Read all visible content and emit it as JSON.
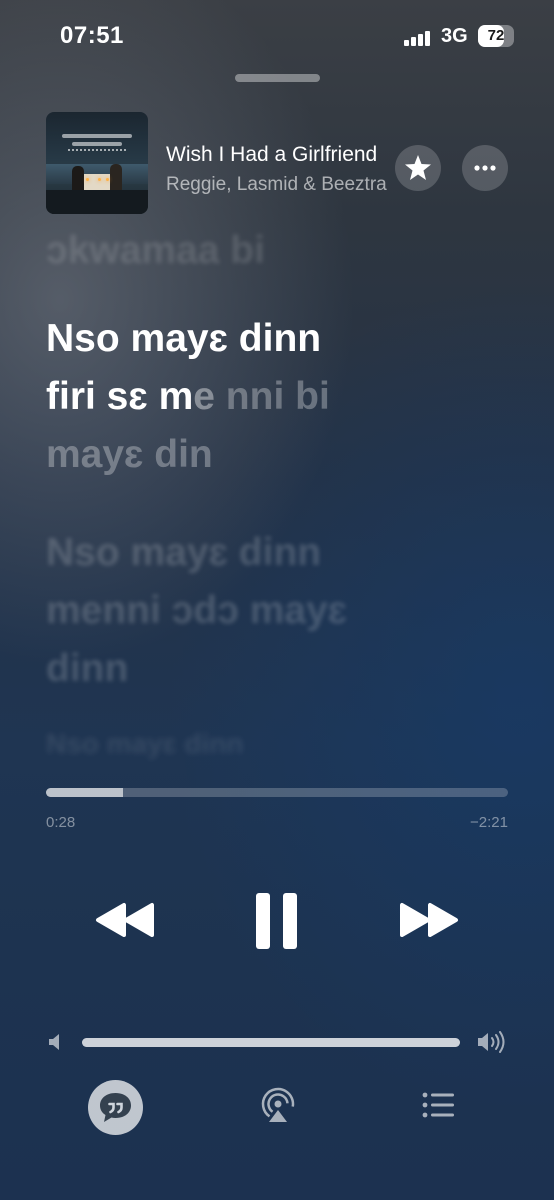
{
  "status_bar": {
    "time": "07:51",
    "network": "3G",
    "battery": "72",
    "battery_level_percent": 72,
    "signal_bars": 4
  },
  "now_playing": {
    "title": "Wish I Had a Girlfriend",
    "artist": "Reggie, Lasmid & Beeztrap KOTM",
    "artwork_icon": "album-artwork"
  },
  "lyrics": {
    "previous": "ɔkwamaa bi",
    "current": {
      "line1": "Nso mayɛ dinn",
      "line2_sung": "firi sɛ m",
      "line2_partial": "e",
      "line2_rest": " nni bi",
      "line3": "mayɛ din"
    },
    "next": {
      "line1": "Nso mayɛ dinn",
      "line2": "menni ɔdɔ mayɛ",
      "line3": "dinn"
    },
    "after": "Nso mayɛ dinn"
  },
  "progress": {
    "elapsed": "0:28",
    "remaining": "−2:21",
    "fraction": 0.166
  },
  "volume": {
    "fraction": 1.0
  },
  "icons": {
    "favorite": "star-icon",
    "more": "ellipsis-icon",
    "rewind": "backward-icon",
    "pause": "pause-icon",
    "forward": "forward-icon",
    "volume_low": "speaker-low-icon",
    "volume_high": "speaker-high-icon",
    "lyrics": "quote-bubble-icon",
    "airplay": "airplay-icon",
    "queue": "list-icon"
  }
}
